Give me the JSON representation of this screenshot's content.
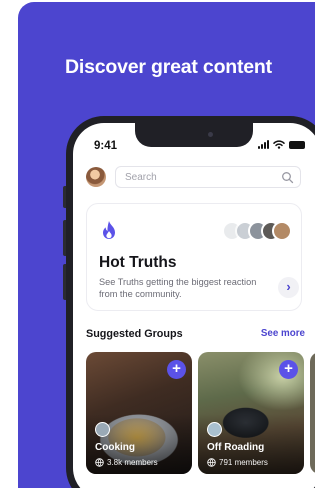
{
  "promo": {
    "headline": "Discover great content",
    "background_color": "#4c45cf"
  },
  "status_bar": {
    "time": "9:41",
    "icons": [
      "signal-icon",
      "wifi-icon",
      "battery-icon"
    ]
  },
  "search": {
    "placeholder": "Search",
    "icon": "search-icon"
  },
  "hot_truths": {
    "icon": "flame-icon",
    "title": "Hot Truths",
    "description": "See Truths getting the biggest reaction from the community.",
    "arrow": "›"
  },
  "suggested_groups": {
    "title": "Suggested Groups",
    "see_more": "See more",
    "groups": [
      {
        "name": "Cooking",
        "members": "3.8k members",
        "add_label": "+"
      },
      {
        "name": "Off Roading",
        "members": "791 members",
        "add_label": "+"
      }
    ]
  },
  "colors": {
    "accent": "#4c45cf",
    "plus_button": "#5b52e8"
  }
}
